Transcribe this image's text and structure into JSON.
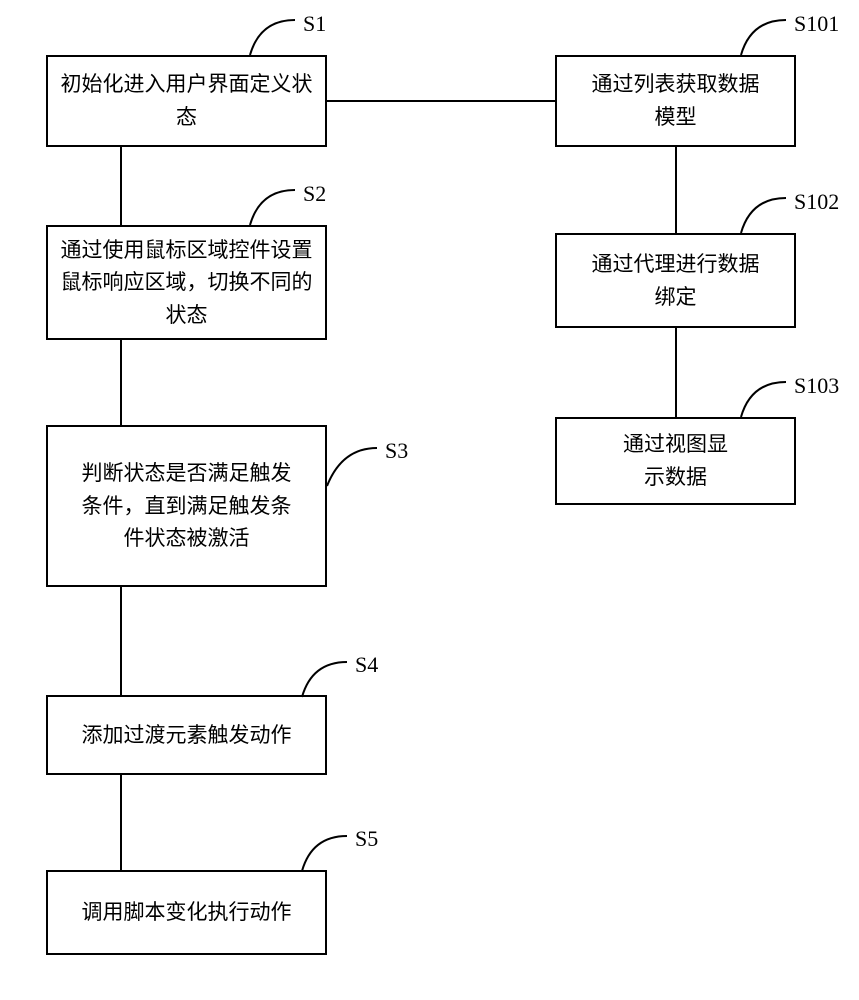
{
  "boxes": {
    "s1": {
      "label": "S1",
      "text": "初始化进入用户界面定义状态"
    },
    "s2": {
      "label": "S2",
      "text": "通过使用鼠标区域控件设置鼠标响应区域，切换不同的状态"
    },
    "s3": {
      "label": "S3",
      "text": "判断状态是否满足触发条件，直到满足触发条件状态被激活"
    },
    "s4": {
      "label": "S4",
      "text": "添加过渡元素触发动作"
    },
    "s5": {
      "label": "S5",
      "text": "调用脚本变化执行动作"
    },
    "s101": {
      "label": "S101",
      "text": "通过列表获取数据模型"
    },
    "s102": {
      "label": "S102",
      "text": "通过代理进行数据绑定"
    },
    "s103": {
      "label": "S103",
      "text": "通过视图显示数据"
    }
  }
}
